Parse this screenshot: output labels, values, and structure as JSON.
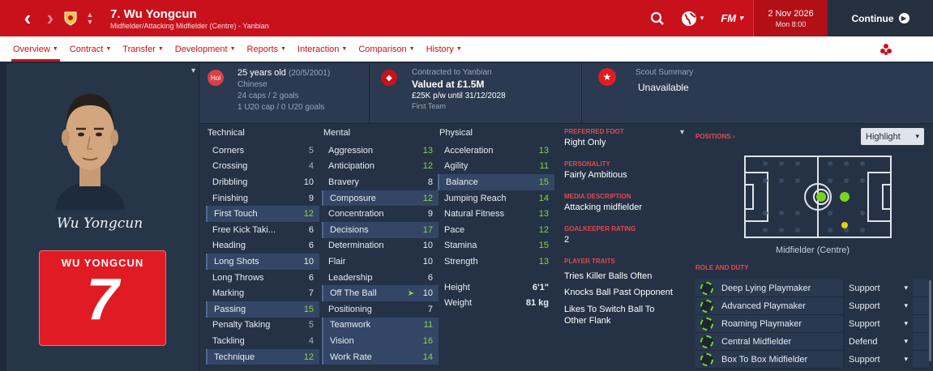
{
  "header": {
    "player_name": "7. Wu Yongcun",
    "subtitle": "Midfielder/Attacking Midfielder (Centre) - Yanbian",
    "date": "2 Nov 2026",
    "time": "Mon 8:00",
    "continue_label": "Continue",
    "fm_label": "FM"
  },
  "tabs": [
    {
      "label": "Overview"
    },
    {
      "label": "Contract"
    },
    {
      "label": "Transfer"
    },
    {
      "label": "Development"
    },
    {
      "label": "Reports"
    },
    {
      "label": "Interaction"
    },
    {
      "label": "Comparison"
    },
    {
      "label": "History"
    }
  ],
  "colors": {
    "brand_red": "#c8111b",
    "green": "#8bd34a"
  },
  "profile": {
    "signature": "Wu Yongcun",
    "shirt_name": "WU YONGCUN",
    "shirt_number": "7"
  },
  "info": {
    "nationality_badge": "Hol",
    "age": "25 years old",
    "dob": "(20/5/2001)",
    "nationality": "Chinese",
    "caps": "24 caps / 2 goals",
    "u20": "1 U20 cap / 0 U20 goals",
    "contract_club": "Contracted to Yanbian",
    "value": "Valued at £1.5M",
    "wage": "£25K p/w until 31/12/2028",
    "squad": "First Team",
    "scout_label": "Scout Summary",
    "scout_value": "Unavailable"
  },
  "technical": {
    "title": "Technical",
    "rows": [
      {
        "name": "Corners",
        "value": "5",
        "hl": false
      },
      {
        "name": "Crossing",
        "value": "4",
        "hl": false
      },
      {
        "name": "Dribbling",
        "value": "10",
        "hl": false
      },
      {
        "name": "Finishing",
        "value": "9",
        "hl": false
      },
      {
        "name": "First Touch",
        "value": "12",
        "hl": true
      },
      {
        "name": "Free Kick Taki...",
        "value": "6",
        "hl": false
      },
      {
        "name": "Heading",
        "value": "6",
        "hl": false
      },
      {
        "name": "Long Shots",
        "value": "10",
        "hl": true
      },
      {
        "name": "Long Throws",
        "value": "6",
        "hl": false
      },
      {
        "name": "Marking",
        "value": "7",
        "hl": false
      },
      {
        "name": "Passing",
        "value": "15",
        "hl": true
      },
      {
        "name": "Penalty Taking",
        "value": "5",
        "hl": false
      },
      {
        "name": "Tackling",
        "value": "4",
        "hl": false
      },
      {
        "name": "Technique",
        "value": "12",
        "hl": true
      }
    ]
  },
  "mental": {
    "title": "Mental",
    "rows": [
      {
        "name": "Aggression",
        "value": "13",
        "hl": false
      },
      {
        "name": "Anticipation",
        "value": "12",
        "hl": false
      },
      {
        "name": "Bravery",
        "value": "8",
        "hl": false
      },
      {
        "name": "Composure",
        "value": "12",
        "hl": true
      },
      {
        "name": "Concentration",
        "value": "9",
        "hl": false
      },
      {
        "name": "Decisions",
        "value": "17",
        "hl": true
      },
      {
        "name": "Determination",
        "value": "10",
        "hl": false
      },
      {
        "name": "Flair",
        "value": "10",
        "hl": false
      },
      {
        "name": "Leadership",
        "value": "6",
        "hl": false
      },
      {
        "name": "Off The Ball",
        "value": "10",
        "hl": true
      },
      {
        "name": "Positioning",
        "value": "7",
        "hl": false
      },
      {
        "name": "Teamwork",
        "value": "11",
        "hl": true
      },
      {
        "name": "Vision",
        "value": "16",
        "hl": true
      },
      {
        "name": "Work Rate",
        "value": "14",
        "hl": true
      }
    ]
  },
  "physical": {
    "title": "Physical",
    "rows": [
      {
        "name": "Acceleration",
        "value": "13",
        "hl": false
      },
      {
        "name": "Agility",
        "value": "11",
        "hl": false
      },
      {
        "name": "Balance",
        "value": "15",
        "hl": true
      },
      {
        "name": "Jumping Reach",
        "value": "14",
        "hl": false
      },
      {
        "name": "Natural Fitness",
        "value": "13",
        "hl": false
      },
      {
        "name": "Pace",
        "value": "12",
        "hl": false
      },
      {
        "name": "Stamina",
        "value": "15",
        "hl": false
      },
      {
        "name": "Strength",
        "value": "13",
        "hl": false
      }
    ],
    "height_label": "Height",
    "height": "6'1\"",
    "weight_label": "Weight",
    "weight": "81 kg"
  },
  "details": {
    "foot_label": "PREFERRED FOOT",
    "foot": "Right Only",
    "personality_label": "PERSONALITY",
    "personality": "Fairly Ambitious",
    "media_label": "MEDIA DESCRIPTION",
    "media": "Attacking midfielder",
    "gk_label": "GOALKEEPER RATING",
    "gk": "2",
    "traits_label": "PLAYER TRAITS",
    "traits": [
      "Tries Killer Balls Often",
      "Knocks Ball Past Opponent",
      "Likes To Switch Ball To Other Flank"
    ]
  },
  "positions": {
    "title": "POSITIONS",
    "highlight_label": "Highlight",
    "position_name": "Midfielder (Centre)",
    "role_title": "ROLE AND DUTY",
    "roles": [
      {
        "role": "Deep Lying Playmaker",
        "duty": "Support"
      },
      {
        "role": "Advanced Playmaker",
        "duty": "Support"
      },
      {
        "role": "Roaming Playmaker",
        "duty": "Support"
      },
      {
        "role": "Central Midfielder",
        "duty": "Defend"
      },
      {
        "role": "Box To Box Midfielder",
        "duty": "Support"
      }
    ]
  }
}
